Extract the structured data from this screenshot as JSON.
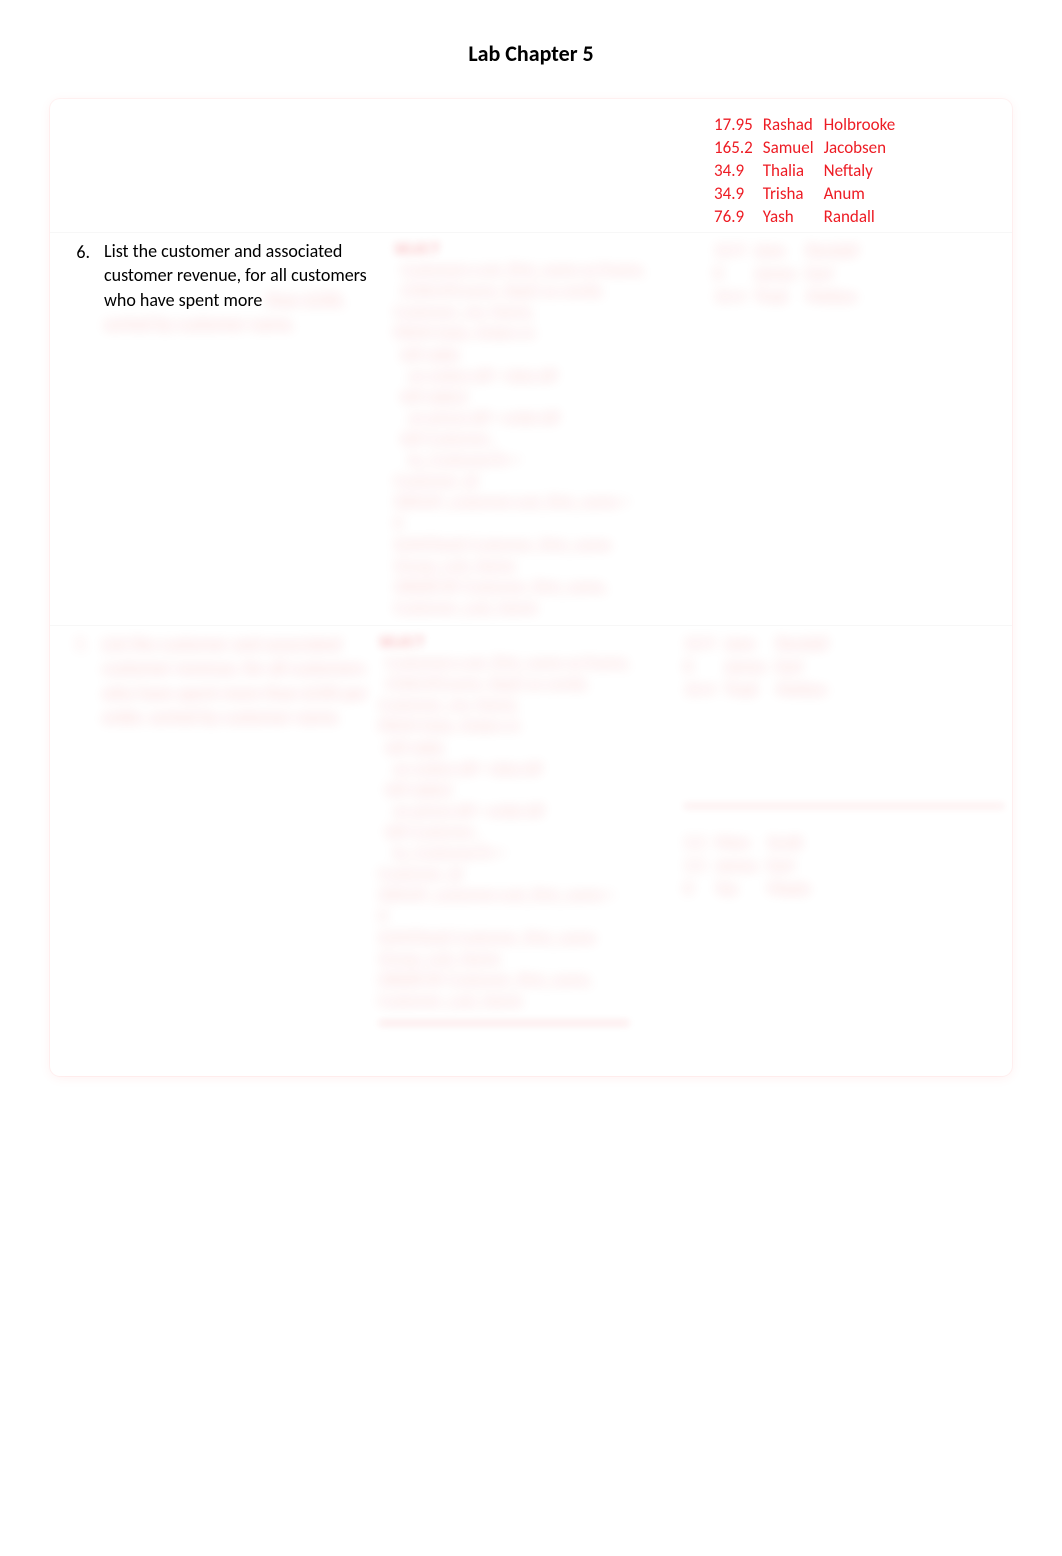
{
  "title": "Lab Chapter 5",
  "topResults": [
    {
      "v": "17.95",
      "fn": "Rashad",
      "ln": "Holbrooke"
    },
    {
      "v": "165.2",
      "fn": "Samuel",
      "ln": "Jacobsen"
    },
    {
      "v": "34.9",
      "fn": "Thalia",
      "ln": "Neftaly"
    },
    {
      "v": "34.9",
      "fn": "Trisha",
      "ln": "Anum"
    },
    {
      "v": "76.9",
      "fn": "Yash",
      "ln": "Randall"
    }
  ],
  "q6": {
    "num": "6.",
    "textVisible": "List the customer and associated customer revenue, for all customers who have spent more",
    "textHidden": "than $100, sorted by customer name.",
    "sqlLabel": "SELECT",
    "sqlBody": "  Customers.cust_first_name as fname,\n  CONCAT(name, dept) as combi,\nCustomer_rev, Name,\nFROM Data, Orders in\n  left table\n    on orders.idf = data.idf\n  left table2\n    on prices.idf = order.idf\n  left Customer_\n    to_Customer.fn =\nCustomer_id\nGROUP_customer.cust_first_name >\n0\nSUM(Total) Customer_first_name\nGroup_Last_Name\nORDER BY Customer_first_name,\nCustomer_Last_Name",
    "resultsHidden": [
      {
        "v": "14.9",
        "fn": "Jane",
        "ln": "Randall"
      },
      {
        "v": "0",
        "fn": "James",
        "ln": "Earl"
      },
      {
        "v": "14.4",
        "fn": "Thali",
        "ln": "Melton"
      }
    ]
  },
  "q7": {
    "num": "7.",
    "textHidden": "List the customer and associated customer revenue, for all customers who have spent more than $100 per order, sorted by customer name.",
    "sqlLabel": "SELECT",
    "sqlBody": "  Customers.cust_first_name as fname,\n  CONCAT(name, dept) as combi,\nCustomer_rev, Name,\nFROM Data, Orders in\n  left table\n    on orders.idf = data.idf\n  left table2\n    on prices.idf = order.idf\n  left Customer_\n    to_Customer.fn =\nCustomer_id\nGROUP_customer.cust_first_name >\n0\nSUM(Total) Customer_first_name\nGroup_Last_Name\nORDER BY Customer_first_name,\nCustomer_Last_Name",
    "resultsHiddenTop": [
      {
        "v": "14.9",
        "fn": "Jane",
        "ln": "Randall"
      },
      {
        "v": "0",
        "fn": "James",
        "ln": "Earl"
      },
      {
        "v": "14.4",
        "fn": "Thali",
        "ln": "Melton"
      }
    ],
    "resultsHiddenBottom": [
      {
        "v": "3.5",
        "fn": "Marc",
        "ln": "Scott"
      },
      {
        "v": "3.5",
        "fn": "James",
        "ln": "Earl"
      },
      {
        "v": "0",
        "fn": "Yaz",
        "ln": "Maxie"
      }
    ]
  }
}
